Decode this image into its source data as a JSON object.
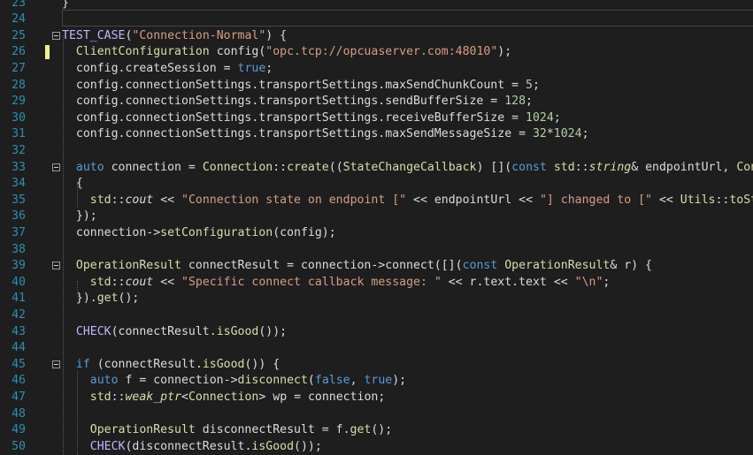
{
  "editor": {
    "lines": [
      {
        "n": "23",
        "segments": [
          {
            "t": "}",
            "c": "pl"
          }
        ]
      },
      {
        "n": "24",
        "segments": []
      },
      {
        "n": "25",
        "segments": [
          {
            "t": "TEST_CASE",
            "c": "tc"
          },
          {
            "t": "(",
            "c": "pl"
          },
          {
            "t": "\"Connection-Normal\"",
            "c": "st"
          },
          {
            "t": ") {",
            "c": "pl"
          }
        ]
      },
      {
        "n": "26",
        "segments": [
          {
            "t": "  ",
            "c": "pl"
          },
          {
            "t": "ClientConfiguration",
            "c": "fn"
          },
          {
            "t": " config(",
            "c": "pl"
          },
          {
            "t": "\"opc.tcp://opcuaserver.com:48010\"",
            "c": "st"
          },
          {
            "t": ");",
            "c": "pl"
          }
        ]
      },
      {
        "n": "27",
        "segments": [
          {
            "t": "  config.",
            "c": "pl"
          },
          {
            "t": "createSession",
            "c": "pl"
          },
          {
            "t": " = ",
            "c": "pl"
          },
          {
            "t": "true",
            "c": "kw"
          },
          {
            "t": ";",
            "c": "pl"
          }
        ]
      },
      {
        "n": "28",
        "segments": [
          {
            "t": "  config.connectionSettings.transportSettings.maxSendChunkCount = ",
            "c": "pl"
          },
          {
            "t": "5",
            "c": "num"
          },
          {
            "t": ";",
            "c": "pl"
          }
        ]
      },
      {
        "n": "29",
        "segments": [
          {
            "t": "  config.connectionSettings.transportSettings.sendBufferSize = ",
            "c": "pl"
          },
          {
            "t": "128",
            "c": "num"
          },
          {
            "t": ";",
            "c": "pl"
          }
        ]
      },
      {
        "n": "30",
        "segments": [
          {
            "t": "  config.connectionSettings.transportSettings.receiveBufferSize = ",
            "c": "pl"
          },
          {
            "t": "1024",
            "c": "num"
          },
          {
            "t": ";",
            "c": "pl"
          }
        ]
      },
      {
        "n": "31",
        "segments": [
          {
            "t": "  config.connectionSettings.transportSettings.maxSendMessageSize = ",
            "c": "pl"
          },
          {
            "t": "32",
            "c": "num"
          },
          {
            "t": "*",
            "c": "pl"
          },
          {
            "t": "1024",
            "c": "num"
          },
          {
            "t": ";",
            "c": "pl"
          }
        ]
      },
      {
        "n": "32",
        "segments": []
      },
      {
        "n": "33",
        "segments": [
          {
            "t": "  ",
            "c": "pl"
          },
          {
            "t": "auto",
            "c": "kw"
          },
          {
            "t": " connection = ",
            "c": "pl"
          },
          {
            "t": "Connection",
            "c": "fn"
          },
          {
            "t": "::",
            "c": "pl"
          },
          {
            "t": "create",
            "c": "fn"
          },
          {
            "t": "((",
            "c": "pl"
          },
          {
            "t": "StateChangeCallback",
            "c": "fn"
          },
          {
            "t": ") [](",
            "c": "pl"
          },
          {
            "t": "const",
            "c": "kw"
          },
          {
            "t": " ",
            "c": "pl"
          },
          {
            "t": "std",
            "c": "fn"
          },
          {
            "t": "::",
            "c": "pl"
          },
          {
            "t": "string",
            "c": "fn it"
          },
          {
            "t": "& endpointUrl, ",
            "c": "pl"
          },
          {
            "t": "Conne",
            "c": "fn"
          }
        ]
      },
      {
        "n": "34",
        "segments": [
          {
            "t": "  {",
            "c": "pl"
          }
        ]
      },
      {
        "n": "35",
        "segments": [
          {
            "t": "    ",
            "c": "pl"
          },
          {
            "t": "std",
            "c": "fn"
          },
          {
            "t": "::",
            "c": "pl"
          },
          {
            "t": "cout",
            "c": "pl it"
          },
          {
            "t": " << ",
            "c": "pl"
          },
          {
            "t": "\"Connection state on endpoint [\"",
            "c": "st"
          },
          {
            "t": " << endpointUrl << ",
            "c": "pl"
          },
          {
            "t": "\"] changed to [\"",
            "c": "st"
          },
          {
            "t": " << ",
            "c": "pl"
          },
          {
            "t": "Utils",
            "c": "fn"
          },
          {
            "t": "::",
            "c": "pl"
          },
          {
            "t": "toStr",
            "c": "fn"
          }
        ]
      },
      {
        "n": "36",
        "segments": [
          {
            "t": "  });",
            "c": "pl"
          }
        ]
      },
      {
        "n": "37",
        "segments": [
          {
            "t": "  connection->",
            "c": "pl"
          },
          {
            "t": "setConfiguration",
            "c": "fn"
          },
          {
            "t": "(config);",
            "c": "pl"
          }
        ]
      },
      {
        "n": "38",
        "segments": []
      },
      {
        "n": "39",
        "segments": [
          {
            "t": "  ",
            "c": "pl"
          },
          {
            "t": "OperationResult",
            "c": "fn"
          },
          {
            "t": " connectResult = connection->connect([](",
            "c": "pl"
          },
          {
            "t": "const",
            "c": "kw"
          },
          {
            "t": " ",
            "c": "pl"
          },
          {
            "t": "OperationResult",
            "c": "fn"
          },
          {
            "t": "& r) {",
            "c": "pl"
          }
        ]
      },
      {
        "n": "40",
        "segments": [
          {
            "t": "    ",
            "c": "pl"
          },
          {
            "t": "std",
            "c": "fn"
          },
          {
            "t": "::",
            "c": "pl"
          },
          {
            "t": "cout",
            "c": "pl it"
          },
          {
            "t": " << ",
            "c": "pl"
          },
          {
            "t": "\"Specific connect callback message: \"",
            "c": "st"
          },
          {
            "t": " << r.text.text << ",
            "c": "pl"
          },
          {
            "t": "\"\\n\"",
            "c": "st"
          },
          {
            "t": ";",
            "c": "pl"
          }
        ]
      },
      {
        "n": "41",
        "segments": [
          {
            "t": "  }).",
            "c": "pl"
          },
          {
            "t": "get",
            "c": "fn"
          },
          {
            "t": "();",
            "c": "pl"
          }
        ]
      },
      {
        "n": "42",
        "segments": []
      },
      {
        "n": "43",
        "segments": [
          {
            "t": "  ",
            "c": "pl"
          },
          {
            "t": "CHECK",
            "c": "tc"
          },
          {
            "t": "(connectResult.",
            "c": "pl"
          },
          {
            "t": "isGood",
            "c": "fn"
          },
          {
            "t": "());",
            "c": "pl"
          }
        ]
      },
      {
        "n": "44",
        "segments": []
      },
      {
        "n": "45",
        "segments": [
          {
            "t": "  ",
            "c": "pl"
          },
          {
            "t": "if",
            "c": "kw"
          },
          {
            "t": " (connectResult.",
            "c": "pl"
          },
          {
            "t": "isGood",
            "c": "fn"
          },
          {
            "t": "()) {",
            "c": "pl"
          }
        ]
      },
      {
        "n": "46",
        "segments": [
          {
            "t": "    ",
            "c": "pl"
          },
          {
            "t": "auto",
            "c": "kw"
          },
          {
            "t": " f = connection->",
            "c": "pl"
          },
          {
            "t": "disconnect",
            "c": "fn"
          },
          {
            "t": "(",
            "c": "pl"
          },
          {
            "t": "false",
            "c": "kw"
          },
          {
            "t": ", ",
            "c": "pl"
          },
          {
            "t": "true",
            "c": "kw"
          },
          {
            "t": ");",
            "c": "pl"
          }
        ]
      },
      {
        "n": "47",
        "segments": [
          {
            "t": "    ",
            "c": "pl"
          },
          {
            "t": "std",
            "c": "fn"
          },
          {
            "t": "::",
            "c": "pl"
          },
          {
            "t": "weak_ptr",
            "c": "fn it"
          },
          {
            "t": "<",
            "c": "pl"
          },
          {
            "t": "Connection",
            "c": "fn"
          },
          {
            "t": "> wp = connection;",
            "c": "pl"
          }
        ]
      },
      {
        "n": "48",
        "segments": []
      },
      {
        "n": "49",
        "segments": [
          {
            "t": "    ",
            "c": "pl"
          },
          {
            "t": "OperationResult",
            "c": "fn"
          },
          {
            "t": " disconnectResult = f.",
            "c": "pl"
          },
          {
            "t": "get",
            "c": "fn"
          },
          {
            "t": "();",
            "c": "pl"
          }
        ]
      },
      {
        "n": "50",
        "segments": [
          {
            "t": "    ",
            "c": "pl"
          },
          {
            "t": "CHECK",
            "c": "tc"
          },
          {
            "t": "(disconnectResult.",
            "c": "pl"
          },
          {
            "t": "isGood",
            "c": "fn"
          },
          {
            "t": "());",
            "c": "pl"
          }
        ]
      }
    ],
    "colors": {
      "background": "#1e1e1e",
      "line_number": "#2b91af",
      "keyword": "#569cd6",
      "string": "#d69d85",
      "function_type": "#dcdcaa",
      "macro": "#beb7ff",
      "number": "#b5cea8",
      "plain": "#dcdcdc",
      "modified_marker": "#efef91"
    }
  }
}
